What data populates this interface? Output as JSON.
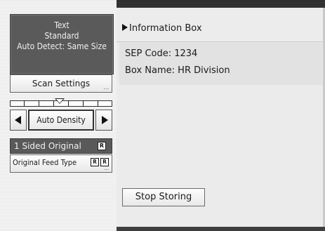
{
  "left_panel": {
    "mode": {
      "line1": "Text",
      "line2": "Standard",
      "line3": "Auto Detect: Same Size"
    },
    "scan_settings_label": "Scan Settings",
    "more_indicator": "...",
    "density": {
      "label": "Auto Density"
    },
    "original": {
      "sided_label": "1 Sided Original",
      "sided_icon_letter": "R",
      "feed_type_label": "Original Feed Type",
      "feed_icon_1": "R",
      "feed_icon_2": "R"
    }
  },
  "main": {
    "title": "Information Box",
    "info": {
      "sep_code": "SEP Code: 1234",
      "box_name": "Box Name: HR Division"
    },
    "stop_storing_label": "Stop Storing"
  }
}
